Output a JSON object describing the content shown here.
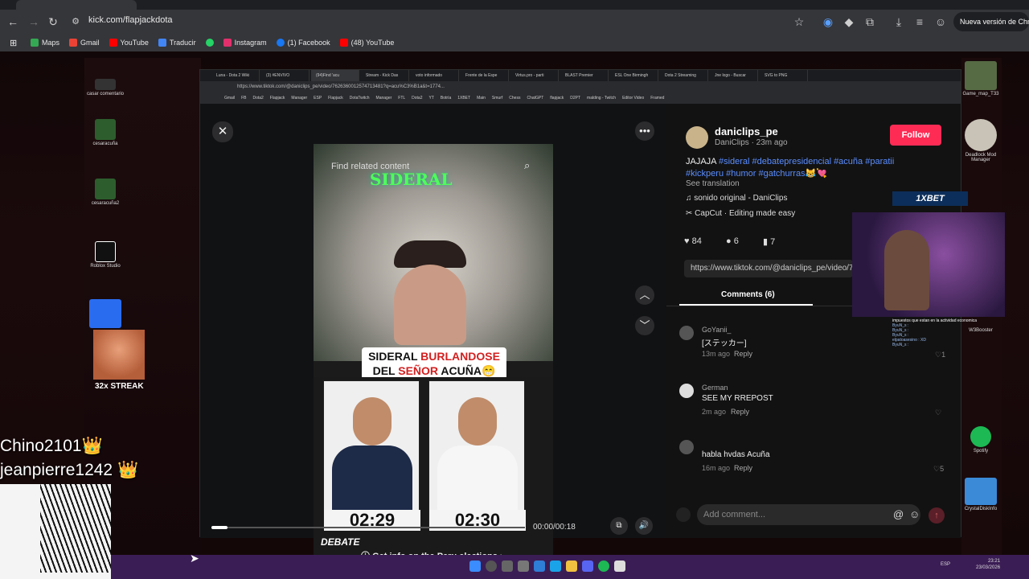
{
  "outer_browser": {
    "url": "kick.com/flapjackdota",
    "update_button": "Nueva versión de Chrome",
    "bookmarks": [
      {
        "label": "Maps",
        "color": "#34a853"
      },
      {
        "label": "Gmail",
        "color": "#ea4335"
      },
      {
        "label": "YouTube",
        "color": "#ff0000"
      },
      {
        "label": "Traducir",
        "color": "#4285f4"
      },
      {
        "label": "",
        "color": "#25d366"
      },
      {
        "label": "Instagram",
        "color": "#e1306c"
      },
      {
        "label": "(1) Facebook",
        "color": "#1877f2"
      },
      {
        "label": "(48) YouTube",
        "color": "#ff0000"
      }
    ]
  },
  "inner_browser": {
    "tabs": [
      "Luna - Dota 2 Wiki",
      "(3) #ENVIVO",
      "(94)Find 'acu",
      "Stream - Kick Das",
      "voto informado",
      "Frente de la Espe",
      "Virtus.pro - parti",
      "BLAST Premier",
      "ESL One Birmingh",
      "Dota 2 Streaming",
      "Jne logo - Buscar",
      "SVG to PNG"
    ],
    "url": "https://www.tiktok.com/@daniclips_pe/video/7626360012574713481?q=acu%C3%B1a&t=1774...",
    "bookmarks": [
      "Gmail",
      "FB",
      "Dota2",
      "Flapjack",
      "Manager",
      "ESP",
      "Flapjack",
      "DotaTwitch",
      "Manager",
      "FTL",
      "Dota2",
      "YT",
      "Botría",
      "1XBET",
      "Main",
      "Smurf",
      "Chess",
      "ChatGPT",
      "flapjack",
      "D2PT",
      "malding - Twitch",
      "Editor Video",
      "Framed"
    ]
  },
  "video": {
    "search_placeholder": "Find related content",
    "logo_text": "SIDERAL",
    "caption_line1_a": "SIDERAL ",
    "caption_line1_b": "BURLANDOSE",
    "caption_line2_a": "DEL ",
    "caption_line2_b": "SEÑOR",
    "caption_line2_c": " ACUÑA😁",
    "timer_left": "02:29",
    "timer_right": "02:30",
    "progress_fraction": 0.05,
    "time": "00:00/00:18",
    "debate_logo": "DEBATE",
    "get_info": "Get info on the Peru elections"
  },
  "post": {
    "username": "daniclips_pe",
    "meta": "DaniClips · 23m ago",
    "follow_label": "Follow",
    "caption_plain": "JAJAJA ",
    "hashtags_line1": "#sideral #debatepresidencial #acuña #paratii",
    "hashtags_line2": "#kickperu #humor #gatchurras",
    "emoji": "😹💘",
    "see_translation": "See translation",
    "sound": "sonido original - DaniClips",
    "capcut": "CapCut · Editing made easy",
    "likes": "84",
    "comments_count": "6",
    "saves": "7",
    "link": "https://www.tiktok.com/@daniclips_pe/video/7",
    "comments_tab": "Comments (6)",
    "comments": [
      {
        "user": "GoYanii_",
        "text": "[ステッカー]",
        "time": "13m ago",
        "reply": "Reply",
        "likes": "1"
      },
      {
        "user": "German",
        "text": "SEE MY RREPOST",
        "time": "2m ago",
        "reply": "Reply",
        "likes": ""
      },
      {
        "user": "",
        "text": "habla hvdas Acuña",
        "time": "16m ago",
        "reply": "Reply",
        "likes": "5"
      }
    ],
    "add_comment_placeholder": "Add comment..."
  },
  "overlays": {
    "name1": "Chino2101",
    "name2": "jeanpierre1242",
    "crown": "👑",
    "streak": "32x STREAK",
    "bet": "1XBET",
    "chat_title": "impuestos que estan en la actividad economica",
    "chat_lines": [
      "ByuN_s :",
      "ByuN_s :",
      "ByuN_s :",
      "elpatoasesino : XD",
      "ByuN_s :"
    ]
  },
  "desktop_left": [
    "casar comentario",
    "cesaracuña",
    "cesaracuña2",
    "Roblox Studio",
    "logo"
  ],
  "desktop_right": [
    "Game_map_T33",
    "Deadlock Mod Manager",
    "W3Booster",
    "Spotify",
    "CrystalDiskInfo"
  ],
  "taskbar": {
    "time": "23:21",
    "date": "23/03/2026",
    "lang": "ESP"
  },
  "colors": {
    "accent": "#fe2c55",
    "tag": "#5a8dff",
    "taskbar": "#3b1d55"
  }
}
